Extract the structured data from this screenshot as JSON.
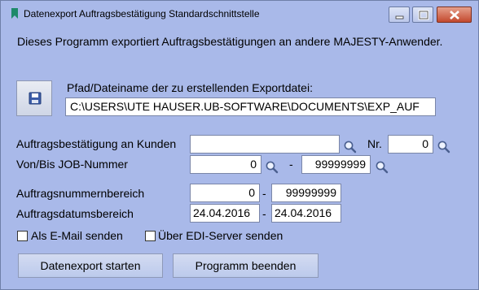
{
  "window": {
    "title": "Datenexport Auftragsbestätigung Standardschnittstelle",
    "controls": [
      "minimize",
      "maximize",
      "close"
    ]
  },
  "intro_text": "Dieses Programm exportiert Auftragsbestätigungen an andere MAJESTY-Anwender.",
  "export_path": {
    "label": "Pfad/Dateiname der zu erstellenden Exportdatei:",
    "value": "C:\\USERS\\UTE HAUSER.UB-SOFTWARE\\DOCUMENTS\\EXP_AUF",
    "button_icon": "save-disk-icon"
  },
  "customer": {
    "label": "Auftragsbestätigung an Kunden",
    "value": "",
    "nr_label": "Nr.",
    "nr_value": "0"
  },
  "job_range": {
    "label": "Von/Bis JOB-Nummer",
    "from": "0",
    "separator": "-",
    "to": "99999999"
  },
  "order_number_range": {
    "label": "Auftragsnummernbereich",
    "from": "0",
    "separator": "-",
    "to": "99999999"
  },
  "order_date_range": {
    "label": "Auftragsdatumsbereich",
    "from": "24.04.2016",
    "separator": "-",
    "to": "24.04.2016"
  },
  "options": {
    "email_label": "Als E-Mail senden",
    "email_checked": false,
    "edi_label": "Über EDI-Server senden",
    "edi_checked": false
  },
  "buttons": {
    "start": "Datenexport starten",
    "end": "Programm beenden"
  },
  "colors": {
    "window_bg": "#a9b9e9",
    "close_button": "#c3492e",
    "app_icon": "#1e8a6a"
  }
}
